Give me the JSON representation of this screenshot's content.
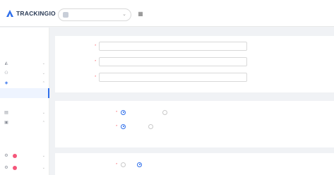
{
  "brand": {
    "name": "TRACKINGIO"
  },
  "header": {
    "app_select_value": "",
    "app_select_chevron": "⌄",
    "grid_icon": "grid-icon"
  },
  "sidebar": {
    "items": [
      {
        "label": "",
        "type": "sub"
      },
      {
        "label": "",
        "type": "sub"
      },
      {
        "label": "",
        "type": "sub"
      },
      {
        "label": "",
        "type": "top",
        "icon": "chart-icon"
      },
      {
        "label": "",
        "type": "top",
        "icon": "users-icon"
      },
      {
        "label": "",
        "type": "top",
        "icon": "megaphone-icon"
      },
      {
        "label": "",
        "type": "sub",
        "active": true
      },
      {
        "label": "",
        "type": "sub"
      },
      {
        "label": "",
        "type": "top",
        "icon": "report-icon"
      },
      {
        "label": "",
        "type": "top",
        "icon": "settings-icon"
      },
      {
        "label": "",
        "type": "sub"
      },
      {
        "label": "",
        "type": "sub"
      },
      {
        "label": "",
        "type": "top",
        "icon": "shield-icon",
        "badge": true
      },
      {
        "label": "",
        "type": "top",
        "icon": "guard-icon",
        "badge": true
      }
    ]
  },
  "main": {
    "section_title": "",
    "form": [
      {
        "label": "",
        "value": ""
      },
      {
        "label": "",
        "value": ""
      },
      {
        "label": "",
        "value": ""
      }
    ],
    "radio_groups": [
      {
        "label": "",
        "options": [
          {
            "label": "",
            "checked": true
          },
          {
            "label": "",
            "checked": false
          }
        ]
      },
      {
        "label": "",
        "options": [
          {
            "label": "",
            "checked": true
          },
          {
            "label": "",
            "checked": false
          }
        ]
      },
      {
        "label": "",
        "options": [
          {
            "label": "",
            "checked": false
          },
          {
            "label": "",
            "checked": true
          }
        ]
      }
    ]
  },
  "colors": {
    "accent": "#2f6feb",
    "required": "#f5222d",
    "badge": "#f5567a"
  }
}
